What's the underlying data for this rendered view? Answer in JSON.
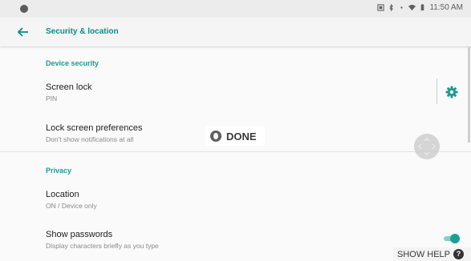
{
  "status_bar": {
    "time": "11:50 AM"
  },
  "app_bar": {
    "title": "Security & location",
    "back_icon": "arrow-left-icon"
  },
  "sections": {
    "device_security": {
      "header": "Device security",
      "screen_lock": {
        "title": "Screen lock",
        "summary": "PIN",
        "settings_icon": "gear-icon"
      },
      "lock_screen_prefs": {
        "title": "Lock screen preferences",
        "summary": "Don't show notifications at all"
      }
    },
    "privacy": {
      "header": "Privacy",
      "location": {
        "title": "Location",
        "summary": "ON / Device only"
      },
      "show_passwords": {
        "title": "Show passwords",
        "summary": "Display characters briefly as you type",
        "enabled": true
      }
    }
  },
  "overlay": {
    "done_label": "DONE",
    "help_label": "SHOW HELP",
    "help_glyph": "?"
  },
  "colors": {
    "accent": "#0e8c86",
    "toggle_on": "#1aa197"
  }
}
